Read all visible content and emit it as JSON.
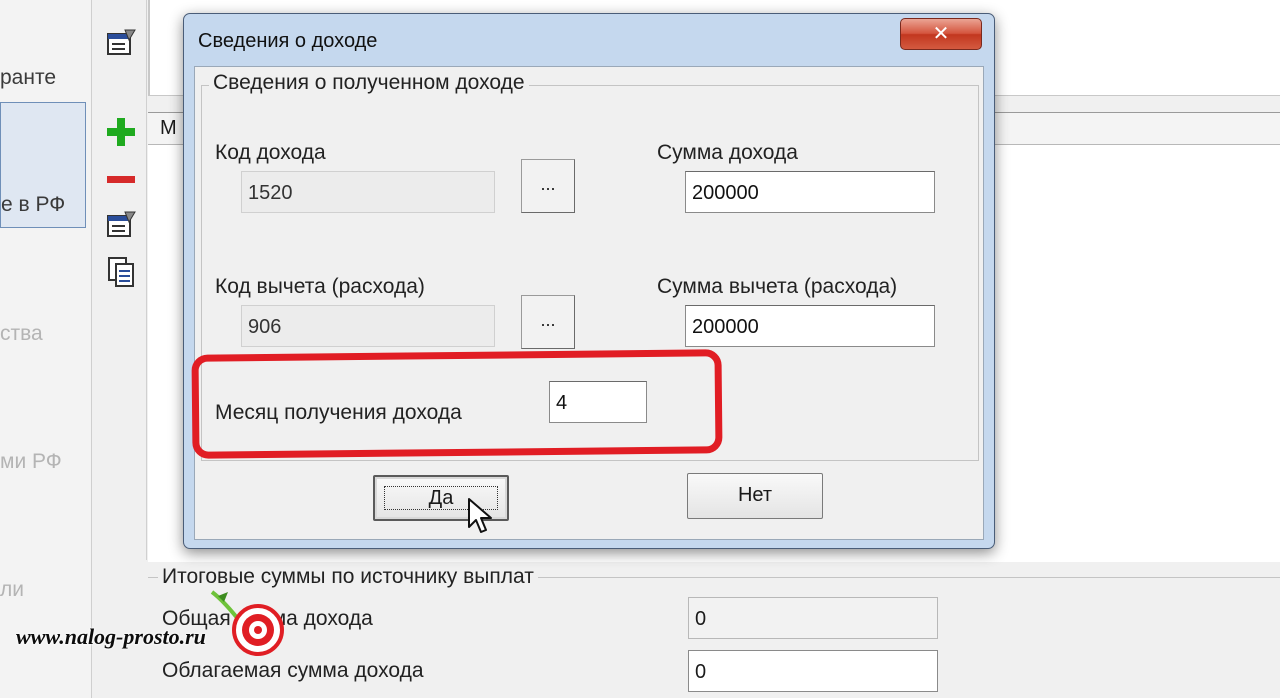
{
  "background": {
    "nav_items": [
      "ранте",
      "е в РФ",
      "ства",
      "ми РФ",
      "ли"
    ],
    "grid_header_cell": "М",
    "totals_group": {
      "legend": "Итоговые суммы по источнику выплат",
      "total_income_label": "Общая сумма дохода",
      "total_income_value": "0",
      "taxable_income_label": "Облагаемая сумма дохода",
      "taxable_income_value": "0"
    }
  },
  "dialog": {
    "title": "Сведения о доходе",
    "close_label": "✕",
    "group_legend": "Сведения о полученном доходе",
    "income_code_label": "Код дохода",
    "income_code_value": "1520",
    "income_sum_label": "Сумма дохода",
    "income_sum_value": "200000",
    "deduction_code_label": "Код вычета (расхода)",
    "deduction_code_value": "906",
    "deduction_sum_label": "Сумма вычета (расхода)",
    "deduction_sum_value": "200000",
    "browse_label": "...",
    "month_label": "Месяц получения дохода",
    "month_value": "4",
    "ok_label": "Да",
    "cancel_label": "Нет"
  },
  "watermark": {
    "text": "www.nalog-prosto.ru"
  },
  "colors": {
    "highlight": "#e11d24",
    "dialog_frame": "#c5d8ee",
    "close_button": "#c2371f"
  }
}
